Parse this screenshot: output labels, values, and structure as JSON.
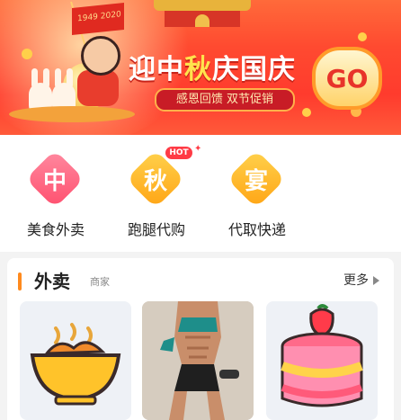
{
  "banner": {
    "flag_text": "1949  2020",
    "slogan_1": "迎中",
    "slogan_2": "秋",
    "slogan_3": "庆",
    "slogan_4": "国庆",
    "sub": "感恩回馈 双节促销",
    "go": "GO"
  },
  "services": [
    {
      "icon_char": "中",
      "label": "美食外卖",
      "color": "#ff5d7c"
    },
    {
      "icon_char": "秋",
      "label": "跑腿代购",
      "color": "#ffb11c",
      "badge": "HOT"
    },
    {
      "icon_char": "宴",
      "label": "代取快递",
      "color": "#ffb11c"
    }
  ],
  "section": {
    "title": "外卖",
    "subtitle": "商家",
    "more": "更多"
  }
}
